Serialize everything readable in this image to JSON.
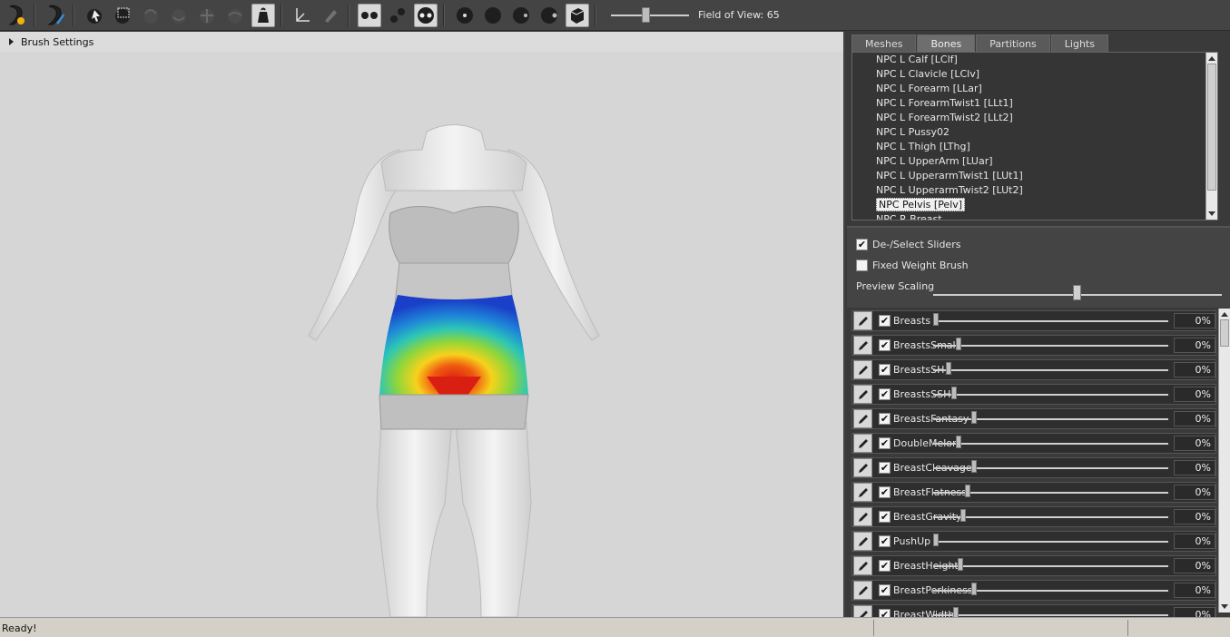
{
  "toolbar": {
    "fov_label": "Field of View: 65",
    "fov_value": 65,
    "fov_fraction": 0.44
  },
  "viewport": {
    "brush_settings_label": "Brush Settings"
  },
  "tabs": [
    {
      "label": "Meshes",
      "active": false
    },
    {
      "label": "Bones",
      "active": true
    },
    {
      "label": "Partitions",
      "active": false
    },
    {
      "label": "Lights",
      "active": false
    }
  ],
  "bones": [
    "NPC L Calf [LClf]",
    "NPC L Clavicle [LClv]",
    "NPC L Forearm [LLar]",
    "NPC L ForearmTwist1 [LLt1]",
    "NPC L ForearmTwist2 [LLt2]",
    "NPC L Pussy02",
    "NPC L Thigh [LThg]",
    "NPC L UpperArm [LUar]",
    "NPC L UpperarmTwist1 [LUt1]",
    "NPC L UpperarmTwist2 [LUt2]",
    "NPC Pelvis [Pelv]",
    "NPC R Breast"
  ],
  "selected_bone_index": 10,
  "options": {
    "deselect_sliders": {
      "label": "De-/Select Sliders",
      "checked": true
    },
    "fixed_weight_brush": {
      "label": "Fixed Weight Brush",
      "checked": false
    },
    "preview_scaling": {
      "label": "Preview Scaling",
      "fraction": 0.5
    }
  },
  "sliders": [
    {
      "name": "Breasts",
      "value": "0%",
      "pos": 0.0,
      "checked": true
    },
    {
      "name": "BreastsSmall",
      "value": "0%",
      "pos": 0.1,
      "checked": true
    },
    {
      "name": "BreastsSH",
      "value": "0%",
      "pos": 0.055,
      "checked": true
    },
    {
      "name": "BreastsSSH",
      "value": "0%",
      "pos": 0.08,
      "checked": true
    },
    {
      "name": "BreastsFantasy",
      "value": "0%",
      "pos": 0.17,
      "checked": true
    },
    {
      "name": "DoubleMelon",
      "value": "0%",
      "pos": 0.1,
      "checked": true
    },
    {
      "name": "BreastCleavage",
      "value": "0%",
      "pos": 0.17,
      "checked": true
    },
    {
      "name": "BreastFlatness",
      "value": "0%",
      "pos": 0.14,
      "checked": true
    },
    {
      "name": "BreastGravity",
      "value": "0%",
      "pos": 0.12,
      "checked": true
    },
    {
      "name": "PushUp",
      "value": "0%",
      "pos": 0.0,
      "checked": true
    },
    {
      "name": "BreastHeight",
      "value": "0%",
      "pos": 0.11,
      "checked": true
    },
    {
      "name": "BreastPerkiness",
      "value": "0%",
      "pos": 0.17,
      "checked": true
    },
    {
      "name": "BreastWidth",
      "value": "0%",
      "pos": 0.09,
      "checked": true
    }
  ],
  "status": {
    "text": "Ready!"
  },
  "colors": {
    "viewport_bg": "#d6d6d6",
    "panel_bg": "#3a3a3a",
    "weight_hot": "#e0261a",
    "weight_cold": "#1f4fd0"
  },
  "icons": [
    "outfit-studio-icon",
    "brush-icon",
    "select-icon",
    "mask-icon",
    "inflate-icon",
    "deflate-icon",
    "move-icon",
    "smooth-icon",
    "weight-brush-icon",
    "transform-icon",
    "pencil-icon",
    "vertex-view-icon",
    "wireframe-icon",
    "lighting-icon",
    "brush-size-small-icon",
    "brush-size-medium-icon",
    "brush-size-large-icon",
    "brush-falloff-icon",
    "textures-icon"
  ]
}
